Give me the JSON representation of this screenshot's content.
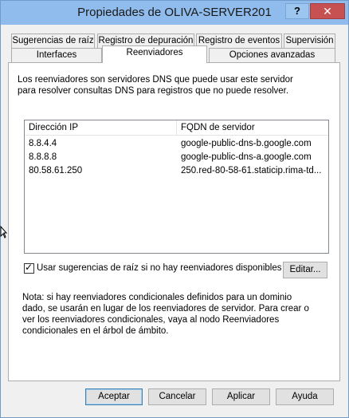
{
  "window": {
    "title": "Propiedades de OLIVA-SERVER201",
    "help_label": "?",
    "close_label": "✕"
  },
  "tabs": {
    "row1": [
      {
        "label": "Sugerencias de raíz"
      },
      {
        "label": "Registro de depuración"
      },
      {
        "label": "Registro de eventos"
      },
      {
        "label": "Supervisión"
      }
    ],
    "row2": [
      {
        "label": "Interfaces"
      },
      {
        "label": "Reenviadores"
      },
      {
        "label": "Opciones avanzadas"
      }
    ],
    "active": "Reenviadores"
  },
  "panel": {
    "description": "Los reenviadores son servidores DNS que puede usar este servidor para resolver consultas DNS para registros que no puede resolver.",
    "list": {
      "columns": [
        "Dirección IP",
        "FQDN de servidor"
      ],
      "rows": [
        {
          "ip": "8.8.4.4",
          "fqdn": "google-public-dns-b.google.com"
        },
        {
          "ip": "8.8.8.8",
          "fqdn": "google-public-dns-a.google.com"
        },
        {
          "ip": "80.58.61.250",
          "fqdn": "250.red-80-58-61.staticip.rima-td..."
        }
      ]
    },
    "use_root_hints": {
      "checked": true,
      "label": "Usar sugerencias de raíz si no hay reenviadores disponibles"
    },
    "edit_button": "Editar...",
    "note": "Nota: si hay reenviadores condicionales definidos para un dominio dado, se usarán en lugar de los reenviadores de servidor. Para crear o ver los reenviadores condicionales, vaya al nodo Reenviadores condicionales en el árbol de ámbito."
  },
  "footer": {
    "ok": "Aceptar",
    "cancel": "Cancelar",
    "apply": "Aplicar",
    "help": "Ayuda"
  },
  "colors": {
    "titlebar": "#8fbcec",
    "close": "#c75050",
    "face": "#f0f0f0"
  }
}
